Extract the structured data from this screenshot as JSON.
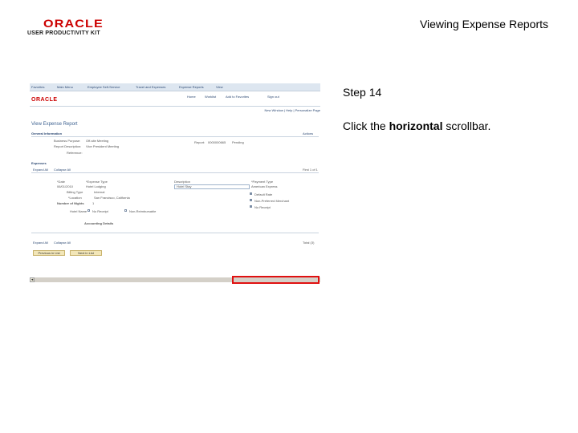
{
  "header": {
    "logo_word": "ORACLE",
    "logo_sub": "USER PRODUCTIVITY KIT",
    "title": "Viewing Expense Reports"
  },
  "screenshot": {
    "menu": [
      "Favorites",
      "Main Menu",
      "Employee Self-Service",
      "Travel and Expenses",
      "Expense Reports",
      "View"
    ],
    "links": [
      "Home",
      "Worklist",
      "Add to Favorites",
      "Sign out"
    ],
    "logo": "ORACLE",
    "new_window": "New Window | Help | Personalize Page",
    "page_title": "View Expense Report",
    "general_info": "General Information",
    "actions": "Actions",
    "business_purpose_label": "Business Purpose:",
    "business_purpose": "Off-site Meeting",
    "report_desc_label": "Report Description:",
    "report_desc": "Vice President Meeting",
    "reference_label": "Reference:",
    "report_label": "Report:",
    "report_id": "0000000665",
    "report_status": "Pending",
    "expenses_label": "Expenses",
    "expand_all": "Expand All",
    "collapse_all": "Collapse All",
    "date_label": "*Date",
    "date_value": "06/01/2010",
    "expense_type_label": "*Expense Type",
    "expense_type": "Hotel Lodging",
    "billing_type_label": "Billing Type",
    "billing_type": "Internal",
    "location_label": "*Location",
    "location": "San Francisco, California",
    "nights_label": "Number of Nights",
    "nights": "1",
    "no_receipt": "No Receipt",
    "non_reimbursable": "Non-Reimbursable",
    "description_label": "Description",
    "description_value": "Hotel Stay",
    "payment_type_label": "*Payment Type",
    "payment_type": "American Express",
    "default_rate": "Default Rate",
    "non_preferred": "Non-Preferred Merchant",
    "no_receipt2": "No Receipt",
    "hotel_name": "Hotel Name",
    "accounting_details": "Accounting Details",
    "previous_in_list": "Previous in List",
    "next_in_list": "Next in List",
    "first_row": "First 1 of 1",
    "total_label": "Total (3)"
  },
  "instruction": {
    "step": "Step 14",
    "prefix": "Click the ",
    "bold": "horizontal",
    "suffix": " scrollbar."
  }
}
